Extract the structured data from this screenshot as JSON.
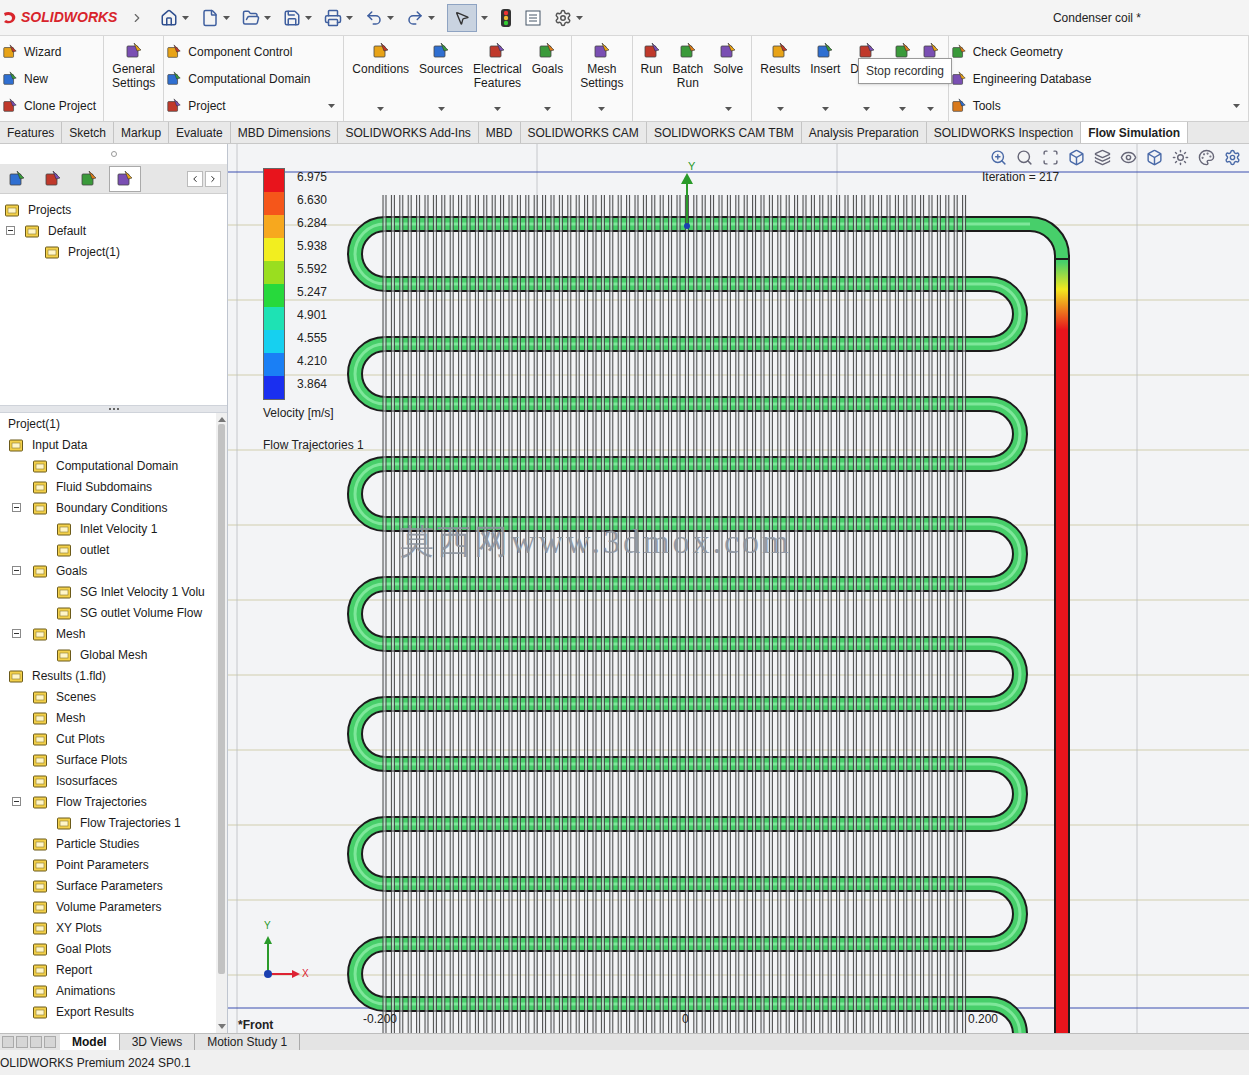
{
  "window": {
    "title": "Condenser coil *"
  },
  "logo": {
    "name": "SOLIDWORKS"
  },
  "ribbon": [
    {
      "kind": "stack",
      "items": [
        {
          "label": "Wizard",
          "dropdown": false
        },
        {
          "label": "New",
          "dropdown": false
        },
        {
          "label": "Clone Project",
          "dropdown": false
        }
      ]
    },
    {
      "kind": "large",
      "items": [
        {
          "label": "General Settings",
          "dropdown": false
        }
      ]
    },
    {
      "kind": "stack",
      "items": [
        {
          "label": "Component Control",
          "dropdown": false
        },
        {
          "label": "Computational Domain",
          "dropdown": false
        },
        {
          "label": "Project",
          "dropdown": true
        }
      ]
    },
    {
      "kind": "large",
      "items": [
        {
          "label": "Conditions",
          "dropdown": true
        },
        {
          "label": "Sources",
          "dropdown": true
        },
        {
          "label": "Electrical Features",
          "dropdown": true
        },
        {
          "label": "Goals",
          "dropdown": true
        }
      ]
    },
    {
      "kind": "large",
      "items": [
        {
          "label": "Mesh Settings",
          "dropdown": true
        }
      ]
    },
    {
      "kind": "large",
      "items": [
        {
          "label": "Run",
          "dropdown": false
        },
        {
          "label": "Batch Run",
          "dropdown": false
        },
        {
          "label": "Solve",
          "dropdown": true
        }
      ]
    },
    {
      "kind": "large",
      "items": [
        {
          "label": "Results",
          "dropdown": true
        },
        {
          "label": "Insert",
          "dropdown": true
        },
        {
          "label": "Displa",
          "dropdown": true
        },
        {
          "label": "",
          "dropdown": true
        },
        {
          "label": "",
          "dropdown": true
        }
      ]
    },
    {
      "kind": "stack",
      "items": [
        {
          "label": "Check Geometry",
          "dropdown": false
        },
        {
          "label": "Engineering Database",
          "dropdown": false
        },
        {
          "label": "Tools",
          "dropdown": true
        }
      ]
    }
  ],
  "tooltip": "Stop recording",
  "tabs": [
    {
      "label": "Features",
      "selected": false
    },
    {
      "label": "Sketch",
      "selected": false
    },
    {
      "label": "Markup",
      "selected": false
    },
    {
      "label": "Evaluate",
      "selected": false
    },
    {
      "label": "MBD Dimensions",
      "selected": false
    },
    {
      "label": "SOLIDWORKS Add-Ins",
      "selected": false
    },
    {
      "label": "MBD",
      "selected": false
    },
    {
      "label": "SOLIDWORKS CAM",
      "selected": false
    },
    {
      "label": "SOLIDWORKS CAM TBM",
      "selected": false
    },
    {
      "label": "Analysis Preparation",
      "selected": false
    },
    {
      "label": "SOLIDWORKS Inspection",
      "selected": false
    },
    {
      "label": "Flow Simulation",
      "selected": true
    }
  ],
  "panel_tabs": [
    {
      "selected": false
    },
    {
      "selected": false
    },
    {
      "selected": false
    },
    {
      "selected": true
    }
  ],
  "project_tree": [
    {
      "label": "Projects",
      "level": 0,
      "has_children": true,
      "expanded": true
    },
    {
      "label": "Default",
      "level": 1,
      "has_children": true,
      "expanded": true
    },
    {
      "label": "Project(1)",
      "level": 2,
      "has_children": false,
      "expanded": false
    }
  ],
  "analysis_tree": [
    {
      "label": "Project(1)",
      "kind": "root",
      "level": 0,
      "has_children": true,
      "expanded": true
    },
    {
      "label": "Input Data",
      "kind": "node",
      "level": 0,
      "has_children": true,
      "expanded": true
    },
    {
      "label": "Computational Domain",
      "kind": "node",
      "level": 1,
      "has_children": false,
      "expanded": false
    },
    {
      "label": "Fluid Subdomains",
      "kind": "node",
      "level": 1,
      "has_children": false,
      "expanded": false
    },
    {
      "label": "Boundary Conditions",
      "kind": "node",
      "level": 1,
      "has_children": true,
      "expanded": true
    },
    {
      "label": "Inlet Velocity 1",
      "kind": "node",
      "level": 2,
      "has_children": false,
      "expanded": false
    },
    {
      "label": "outlet",
      "kind": "node",
      "level": 2,
      "has_children": false,
      "expanded": false
    },
    {
      "label": "Goals",
      "kind": "node",
      "level": 1,
      "has_children": true,
      "expanded": true
    },
    {
      "label": "SG Inlet Velocity 1 Volu",
      "kind": "node",
      "level": 2,
      "has_children": false,
      "expanded": false
    },
    {
      "label": "SG outlet Volume Flow",
      "kind": "node",
      "level": 2,
      "has_children": false,
      "expanded": false
    },
    {
      "label": "Mesh",
      "kind": "node",
      "level": 1,
      "has_children": true,
      "expanded": true
    },
    {
      "label": "Global Mesh",
      "kind": "node",
      "level": 2,
      "has_children": false,
      "expanded": false
    },
    {
      "label": "Results (1.fld)",
      "kind": "node",
      "level": 0,
      "has_children": true,
      "expanded": true
    },
    {
      "label": "Scenes",
      "kind": "node",
      "level": 1,
      "has_children": false,
      "expanded": false
    },
    {
      "label": "Mesh",
      "kind": "node",
      "level": 1,
      "has_children": false,
      "expanded": false
    },
    {
      "label": "Cut Plots",
      "kind": "node",
      "level": 1,
      "has_children": false,
      "expanded": false
    },
    {
      "label": "Surface Plots",
      "kind": "node",
      "level": 1,
      "has_children": false,
      "expanded": false
    },
    {
      "label": "Isosurfaces",
      "kind": "node",
      "level": 1,
      "has_children": false,
      "expanded": false
    },
    {
      "label": "Flow Trajectories",
      "kind": "node",
      "level": 1,
      "has_children": true,
      "expanded": true
    },
    {
      "label": "Flow Trajectories 1",
      "kind": "node",
      "level": 2,
      "has_children": false,
      "expanded": false
    },
    {
      "label": "Particle Studies",
      "kind": "node",
      "level": 1,
      "has_children": false,
      "expanded": false
    },
    {
      "label": "Point Parameters",
      "kind": "node",
      "level": 1,
      "has_children": false,
      "expanded": false
    },
    {
      "label": "Surface Parameters",
      "kind": "node",
      "level": 1,
      "has_children": false,
      "expanded": false
    },
    {
      "label": "Volume Parameters",
      "kind": "node",
      "level": 1,
      "has_children": false,
      "expanded": false
    },
    {
      "label": "XY Plots",
      "kind": "node",
      "level": 1,
      "has_children": false,
      "expanded": false
    },
    {
      "label": "Goal Plots",
      "kind": "node",
      "level": 1,
      "has_children": false,
      "expanded": false
    },
    {
      "label": "Report",
      "kind": "node",
      "level": 1,
      "has_children": false,
      "expanded": false
    },
    {
      "label": "Animations",
      "kind": "node",
      "level": 1,
      "has_children": false,
      "expanded": false
    },
    {
      "label": "Export Results",
      "kind": "node",
      "level": 1,
      "has_children": false,
      "expanded": false
    }
  ],
  "viewport": {
    "iteration": "Iteration = 217",
    "view": "*Front",
    "legend": {
      "title": "Velocity [m/s]",
      "subtitle": "Flow Trajectories 1",
      "stops": [
        {
          "value": "6.975",
          "color": "#e8141c"
        },
        {
          "value": "6.630",
          "color": "#f5561a"
        },
        {
          "value": "6.284",
          "color": "#f7a81e"
        },
        {
          "value": "5.938",
          "color": "#f2ee1f"
        },
        {
          "value": "5.592",
          "color": "#9ade1f"
        },
        {
          "value": "5.247",
          "color": "#27d93c"
        },
        {
          "value": "4.901",
          "color": "#1ee2b4"
        },
        {
          "value": "4.555",
          "color": "#16d0f0"
        },
        {
          "value": "4.210",
          "color": "#1a7ff5"
        },
        {
          "value": "3.864",
          "color": "#1a2ff0"
        }
      ]
    },
    "axis_labels": [
      "-0.200",
      "0",
      "0.200"
    ],
    "origin_label": "Y",
    "triad": {
      "y": "Y",
      "x": "X"
    },
    "watermark": "莫西网www.3dmox.com"
  },
  "bottom_tabs": [
    {
      "label": "Model",
      "selected": true
    },
    {
      "label": "3D Views",
      "selected": false
    },
    {
      "label": "Motion Study 1",
      "selected": false
    }
  ],
  "status_bar": "OLIDWORKS Premium 2024 SP0.1"
}
